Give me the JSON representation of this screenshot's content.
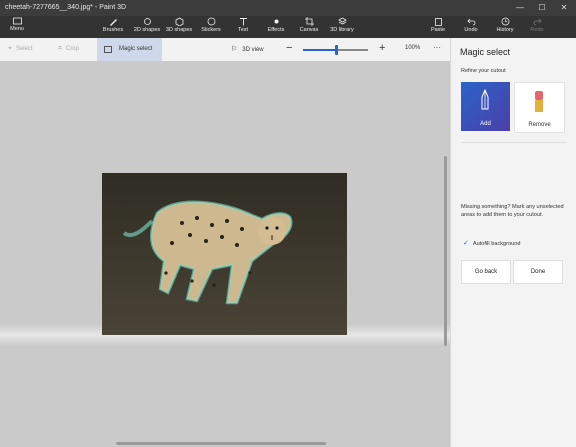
{
  "window": {
    "title": "cheetah-7277665__340.jpg* - Paint 3D",
    "minimize_glyph": "—",
    "maximize_glyph": "☐",
    "close_glyph": "✕"
  },
  "toolbar": {
    "menu": "Menu",
    "brushes": "Brushes",
    "shapes2d": "2D shapes",
    "shapes3d": "3D shapes",
    "stickers": "Stickers",
    "text": "Text",
    "effects": "Effects",
    "canvas": "Canvas",
    "library3d": "3D library",
    "paste": "Paste",
    "undo": "Undo",
    "history": "History",
    "redo": "Redo"
  },
  "subbar": {
    "select": "Select",
    "crop": "Crop",
    "magic_select": "Magic select",
    "view3d": "3D view",
    "zoom": "100%",
    "zoom_minus": "−",
    "zoom_plus": "+",
    "more": "···",
    "zoom_level": 0.5
  },
  "panel": {
    "title": "Magic select",
    "subtitle": "Refine your cutout",
    "add": "Add",
    "remove": "Remove",
    "missing_text": "Missing something? Mark any unselected areas to add them to your cutout.",
    "autofill_check": "✓",
    "autofill": "Autofill background",
    "go_back": "Go back",
    "done": "Done"
  },
  "colors": {
    "accent": "#2b63c8",
    "titlebar": "#3c3c3c",
    "toolbar": "#333333"
  }
}
